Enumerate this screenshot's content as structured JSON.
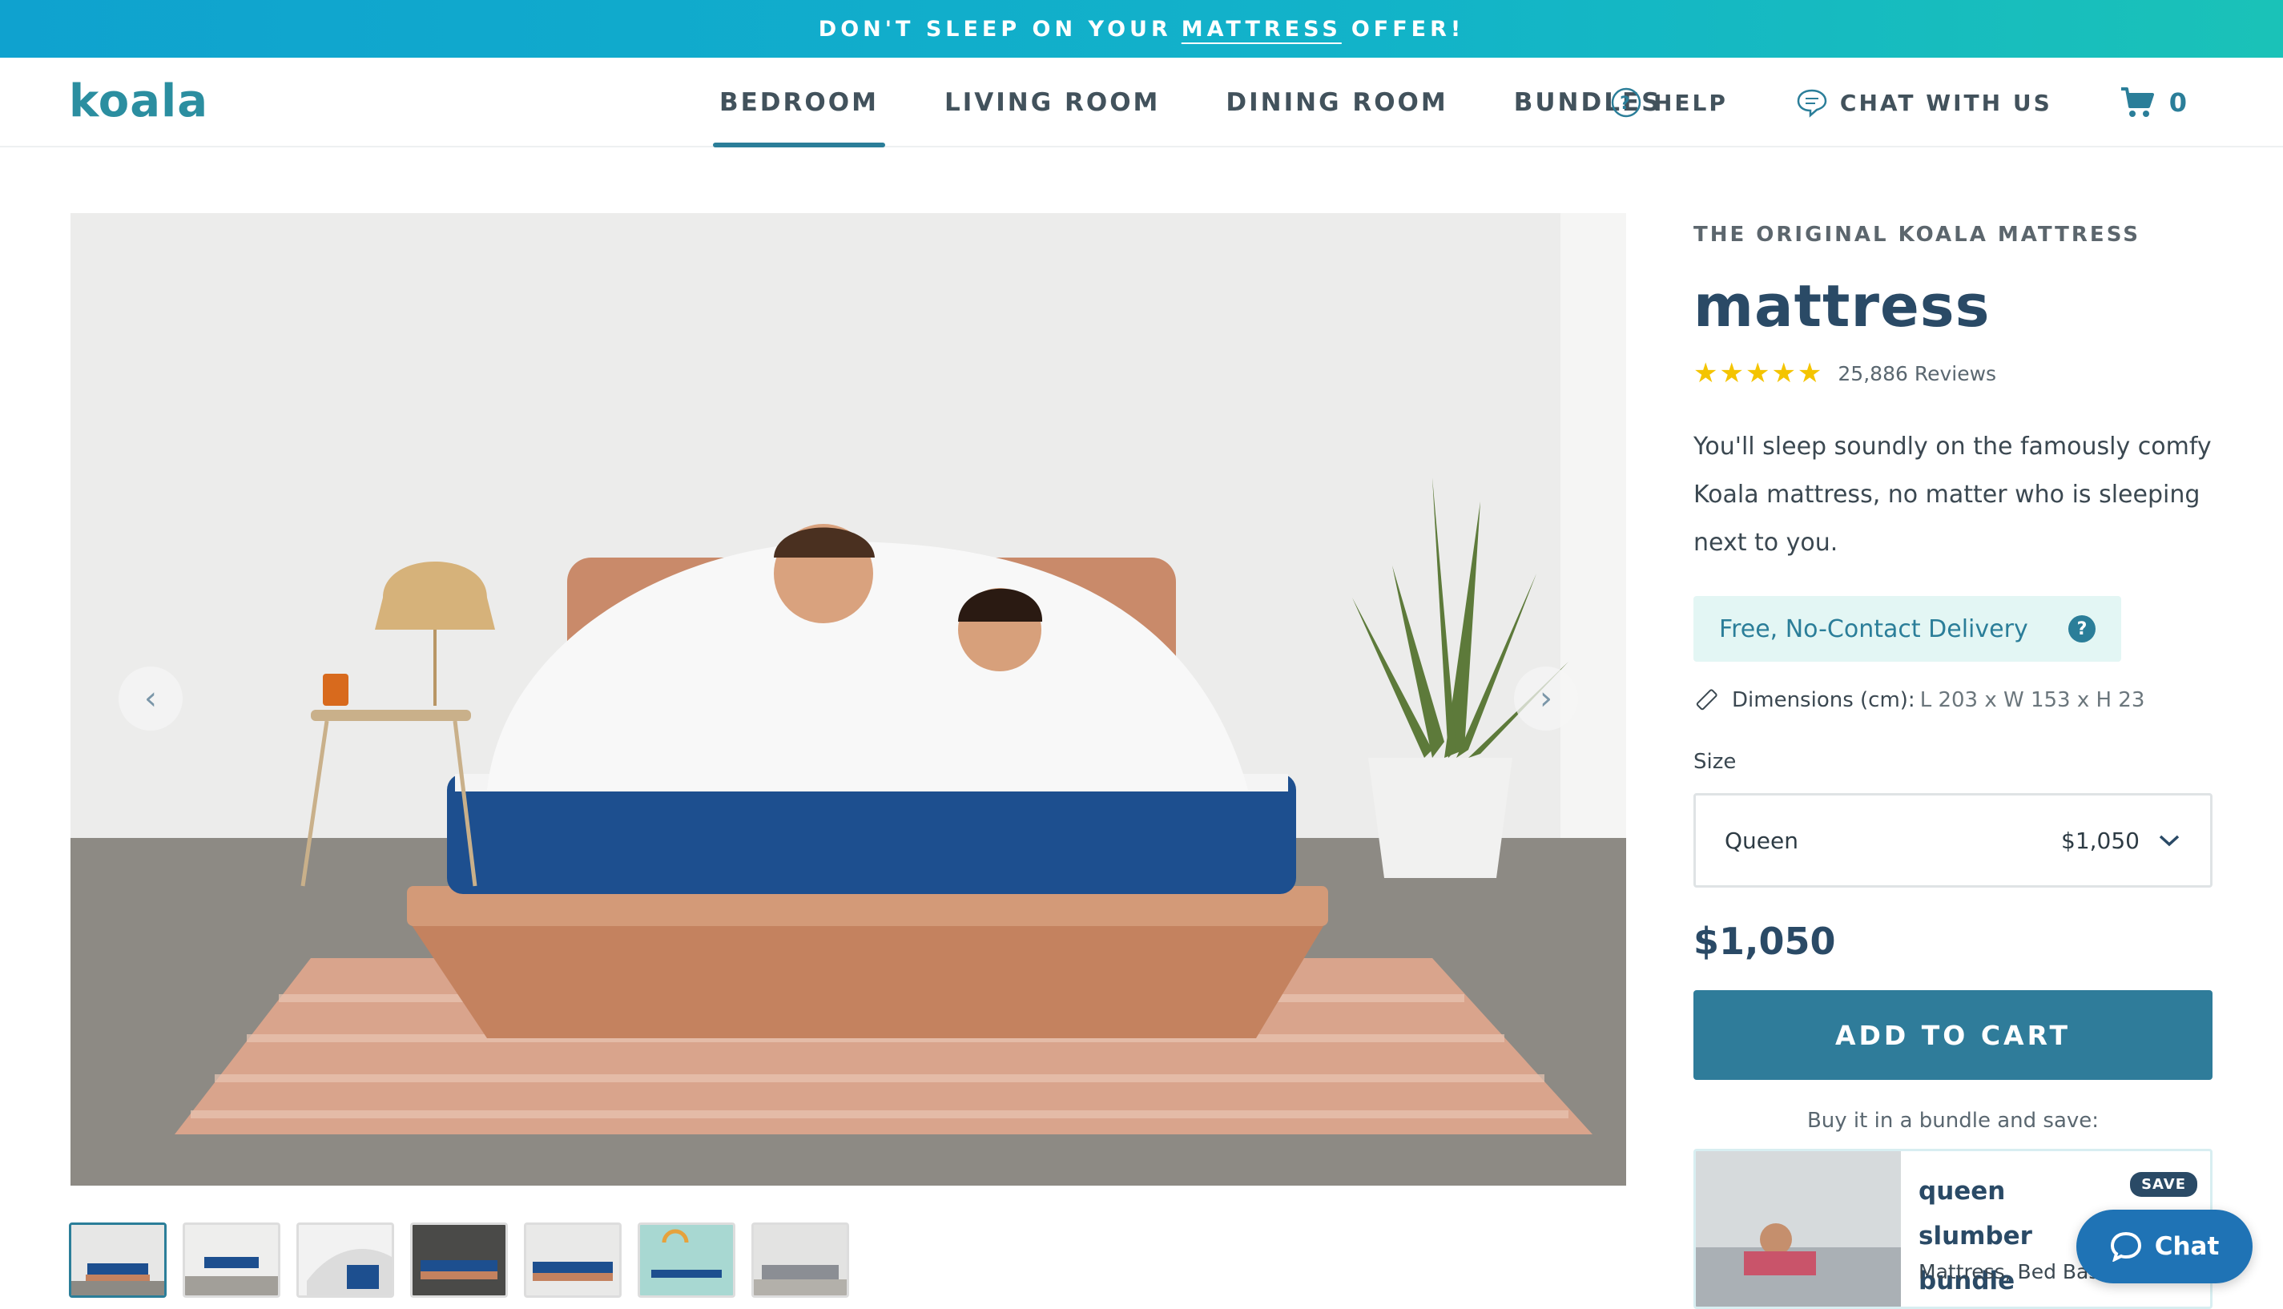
{
  "promo": {
    "before": "DON'T SLEEP ON YOUR",
    "link": "MATTRESS",
    "after": "OFFER!"
  },
  "header": {
    "logo": "koala",
    "nav": [
      "BEDROOM",
      "LIVING ROOM",
      "DINING ROOM",
      "BUNDLES"
    ],
    "active_nav": "BEDROOM",
    "help_label": "HELP",
    "chat_label": "CHAT WITH US",
    "cart_count": "0"
  },
  "gallery": {
    "prev_icon": "chevron-left-icon",
    "next_icon": "chevron-right-icon",
    "thumbnail_count": 7,
    "active_thumbnail": 1
  },
  "product": {
    "eyebrow": "THE ORIGINAL KOALA MATTRESS",
    "title": "mattress",
    "stars": "★★★★★",
    "reviews": "25,886 Reviews",
    "description": "You'll sleep soundly on the famously comfy Koala mattress, no matter who is sleeping next to you.",
    "delivery": "Free, No-Contact Delivery",
    "dimensions_label": "Dimensions (cm):",
    "dimensions_value": "L 203 x W 153 x H 23",
    "size_label": "Size",
    "size_selected": "Queen",
    "size_price": "$1,050",
    "price": "$1,050",
    "add_to_cart": "ADD TO CART",
    "bundle_note": "Buy it in a bundle and save:",
    "bundle_title": "queen slumber bundle",
    "bundle_sub": "Mattress, Bed Base, Pillows,",
    "save_badge": "SAVE"
  },
  "chat_fab": "Chat",
  "colors": {
    "brand": "#2b7e99",
    "title": "#2a4a66",
    "stars": "#f4c400",
    "delivery_bg": "#e3f6f4",
    "chat_fab": "#1f73b5"
  }
}
